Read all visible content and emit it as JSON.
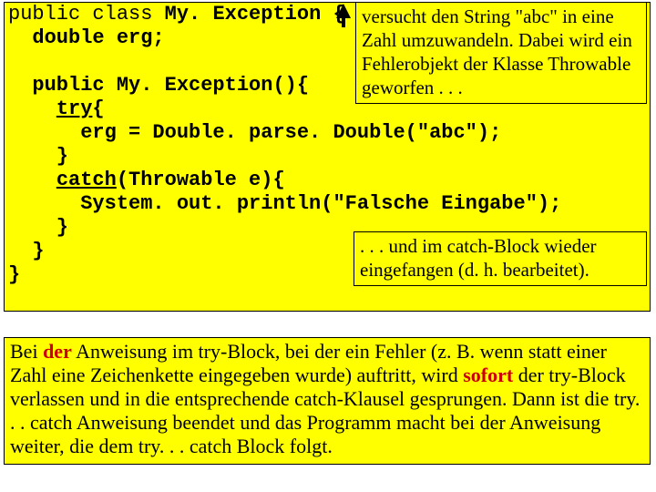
{
  "code": {
    "l1a": "public class ",
    "l1b": "My. Exception {",
    "l2": "  double erg;",
    "l3": "",
    "l4": "  public My. Exception(){",
    "l5a": "    ",
    "l5b": "try",
    "l5c": "{",
    "l6": "      erg = Double. parse. Double(\"abc\");",
    "l7": "    }",
    "l8a": "    ",
    "l8b": "catch",
    "l8c": "(Throwable e){",
    "l9": "      System. out. println(\"Falsche Eingabe\");",
    "l10": "    }",
    "l11": "  }",
    "l12": "}"
  },
  "callout1": "versucht den String \"abc\" in eine Zahl umzuwandeln. Dabei wird ein Fehlerobjekt der Klasse Throwable geworfen . . .",
  "callout2": ". . . und im catch-Block wieder eingefangen (d. h. bearbeitet).",
  "para": {
    "p1": "Bei ",
    "p2": "der",
    "p3": " Anweisung im try-Block, bei der ein Fehler (z. B. wenn statt einer Zahl eine Zeichenkette eingegeben wurde) auftritt, wird ",
    "p4": "sofort",
    "p5": " der try-Block verlassen und in die entsprechende catch-Klausel gesprungen. Dann ist die try. . . catch Anweisung beendet und das Programm macht bei der Anweisung weiter, die dem try. . . catch Block folgt."
  }
}
